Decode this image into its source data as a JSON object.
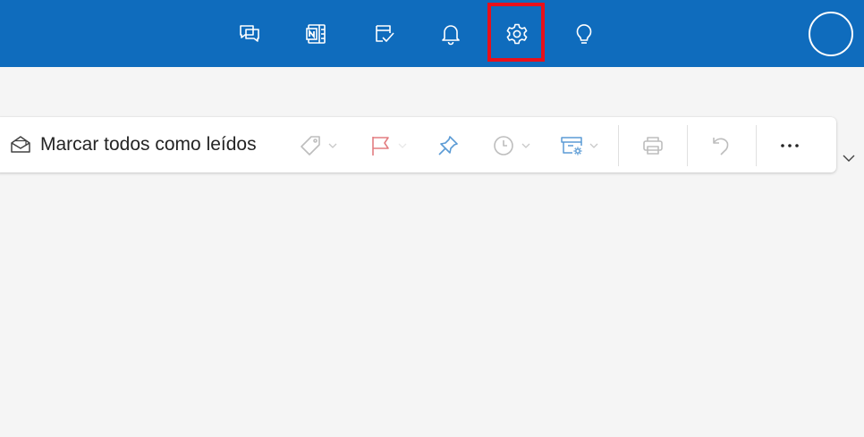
{
  "header": {
    "icons": [
      {
        "name": "chat-icon",
        "label": "Chat"
      },
      {
        "name": "onenote-icon",
        "label": "OneNote"
      },
      {
        "name": "tasks-icon",
        "label": "To Do"
      },
      {
        "name": "bell-icon",
        "label": "Notifications"
      },
      {
        "name": "gear-icon",
        "label": "Settings",
        "highlighted": true
      },
      {
        "name": "lightbulb-icon",
        "label": "Tips"
      }
    ],
    "avatar": "profile-avatar"
  },
  "toolbar": {
    "mark_all_read_label": "Marcar todos como leídos",
    "buttons": [
      {
        "name": "tag-icon",
        "has_dropdown": true
      },
      {
        "name": "flag-icon",
        "has_dropdown": true
      },
      {
        "name": "pin-icon",
        "has_dropdown": false
      },
      {
        "name": "clock-icon",
        "has_dropdown": true
      },
      {
        "name": "archive-settings-icon",
        "has_dropdown": true
      },
      {
        "name": "print-icon",
        "has_dropdown": false
      },
      {
        "name": "undo-icon",
        "has_dropdown": false
      },
      {
        "name": "more-icon",
        "has_dropdown": false
      }
    ]
  },
  "colors": {
    "header_bg": "#0f6cbd",
    "highlight": "#e8101a",
    "flag": "#e37d80",
    "pin": "#5b9bd5",
    "disabled": "#bdbdbd"
  }
}
